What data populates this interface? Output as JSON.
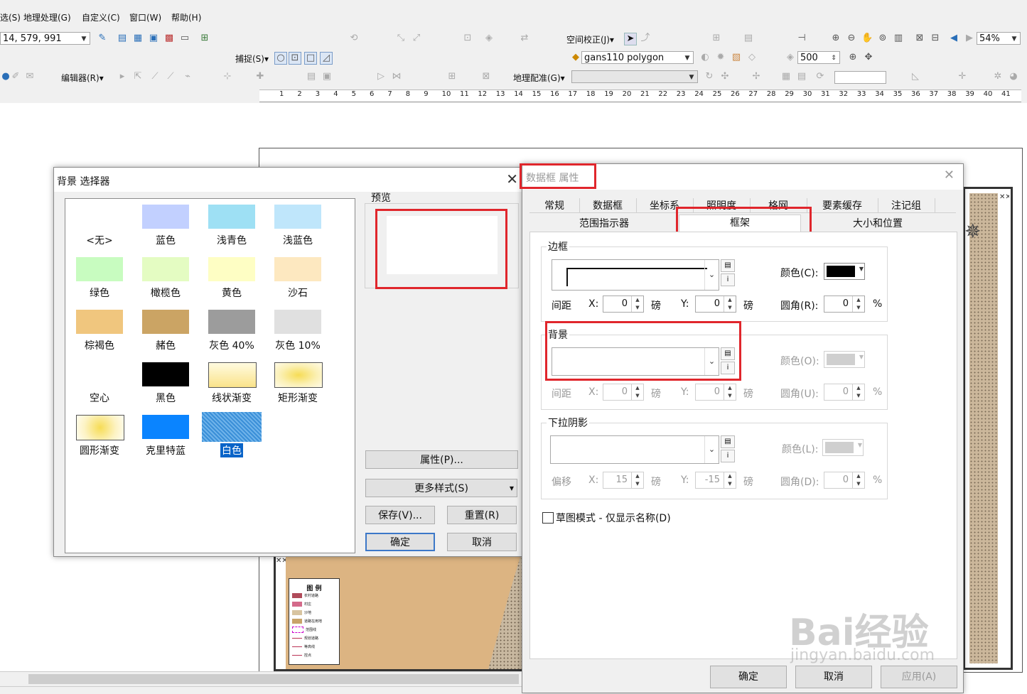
{
  "toolbar": {
    "menu": [
      "选(S)",
      "地理处理(G)",
      "自定义(C)",
      "窗口(W)",
      "帮助(H)"
    ],
    "scale_value": "14, 579, 991",
    "spatial_adjust_label": "空间校正(J)▾",
    "snap_label": "捕捉(S)▾",
    "layer_combo": "gans110 polygon",
    "number_box": "500",
    "zoom_value": "54%",
    "editor_label": "编辑器(R)▾",
    "georef_label": "地理配准(G)▾",
    "ruler_ticks": [
      "1",
      "2",
      "3",
      "4",
      "5",
      "6",
      "7",
      "8",
      "9",
      "10",
      "11",
      "12",
      "13",
      "14",
      "15",
      "16",
      "17",
      "18",
      "19",
      "20",
      "21",
      "22",
      "23",
      "24",
      "25",
      "26",
      "27",
      "28",
      "29",
      "30",
      "31",
      "32",
      "33",
      "34",
      "35",
      "36",
      "37",
      "38",
      "39",
      "40",
      "41"
    ]
  },
  "selector_dialog": {
    "title": "背景 选择器",
    "preview_label": "预览",
    "swatches": [
      {
        "label": "<无>",
        "color": ""
      },
      {
        "label": "蓝色",
        "color": "#c2d0ff"
      },
      {
        "label": "浅青色",
        "color": "#9ee0f4"
      },
      {
        "label": "浅蓝色",
        "color": "#bfe6fb"
      },
      {
        "label": "绿色",
        "color": "#c8fcc0"
      },
      {
        "label": "橄榄色",
        "color": "#e4fcc2"
      },
      {
        "label": "黄色",
        "color": "#fefec4"
      },
      {
        "label": "沙石",
        "color": "#fde8c0"
      },
      {
        "label": "棕褐色",
        "color": "#f0c67e"
      },
      {
        "label": "赭色",
        "color": "#cba464"
      },
      {
        "label": "灰色 40%",
        "color": "#9c9c9c"
      },
      {
        "label": "灰色 10%",
        "color": "#e0e0e0"
      },
      {
        "label": "空心",
        "color": ""
      },
      {
        "label": "黑色",
        "color": "#000000"
      },
      {
        "label": "线状渐变",
        "color": "linear"
      },
      {
        "label": "矩形渐变",
        "color": "rect"
      },
      {
        "label": "圆形渐变",
        "color": "radial"
      },
      {
        "label": "克里特蓝",
        "color": "#0a84ff"
      },
      {
        "label": "白色",
        "color": "selected"
      }
    ],
    "properties_button": "属性(P)...",
    "more_styles_button": "更多样式(S)",
    "save_button": "保存(V)...",
    "reset_button": "重置(R)",
    "ok_button": "确定",
    "cancel_button": "取消"
  },
  "props_dialog": {
    "title": "数据框 属性",
    "tabs_row1": [
      "常规",
      "数据框",
      "坐标系",
      "照明度",
      "格网",
      "要素缓存",
      "注记组"
    ],
    "tabs_row2": [
      "范围指示器",
      "框架",
      "大小和位置"
    ],
    "border_group": "边框",
    "background_group": "背景",
    "shadow_group": "下拉阴影",
    "color_c": "颜色(C):",
    "color_o": "颜色(O):",
    "color_l": "颜色(L):",
    "gap_label": "间距",
    "offset_label": "偏移",
    "x_label": "X:",
    "y_label": "Y:",
    "unit_pt": "磅",
    "radius_r": "圆角(R):",
    "radius_u": "圆角(U):",
    "radius_d": "圆角(D):",
    "percent": "%",
    "border_gap_x": "0",
    "border_gap_y": "0",
    "border_radius": "0",
    "bg_gap_x": "0",
    "bg_gap_y": "0",
    "bg_radius": "0",
    "shadow_x": "15",
    "shadow_y": "-15",
    "shadow_radius": "0",
    "draft_mode": "草图模式 - 仅显示名称(D)",
    "ok_button": "确定",
    "cancel_button": "取消",
    "apply_button": "应用(A)"
  },
  "legend": {
    "title": "图 例",
    "items": [
      "农村道路",
      "村庄",
      "沙地",
      "道路在用地",
      "范围线",
      "规划道路",
      "等高线",
      "控点"
    ]
  },
  "watermark": {
    "brand": "Bai经验",
    "url": "jingyan.baidu.com"
  }
}
